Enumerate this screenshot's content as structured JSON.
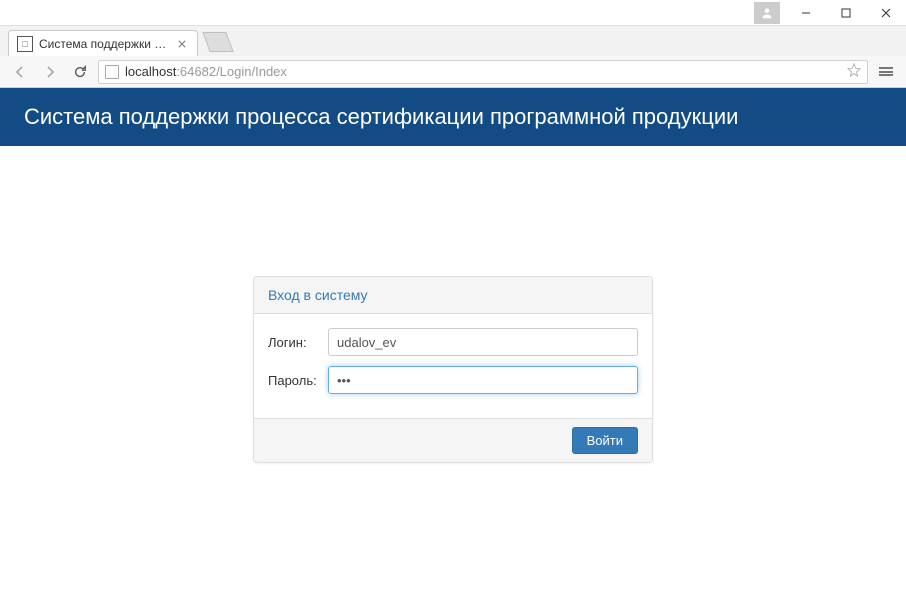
{
  "window": {
    "minimize": "—",
    "maximize": "□",
    "close": "✕"
  },
  "browser": {
    "tab": {
      "title": "Система поддержки про",
      "favicon_text": "⊡"
    },
    "url_host": "localhost",
    "url_rest": ":64682/Login/Index"
  },
  "header": {
    "title": "Система поддержки процесса сертификации программной продукции"
  },
  "login": {
    "panel_title": "Вход в систему",
    "login_label": "Логин:",
    "login_value": "udalov_ev",
    "password_label": "Пароль:",
    "password_value": "•••",
    "submit_label": "Войти"
  }
}
